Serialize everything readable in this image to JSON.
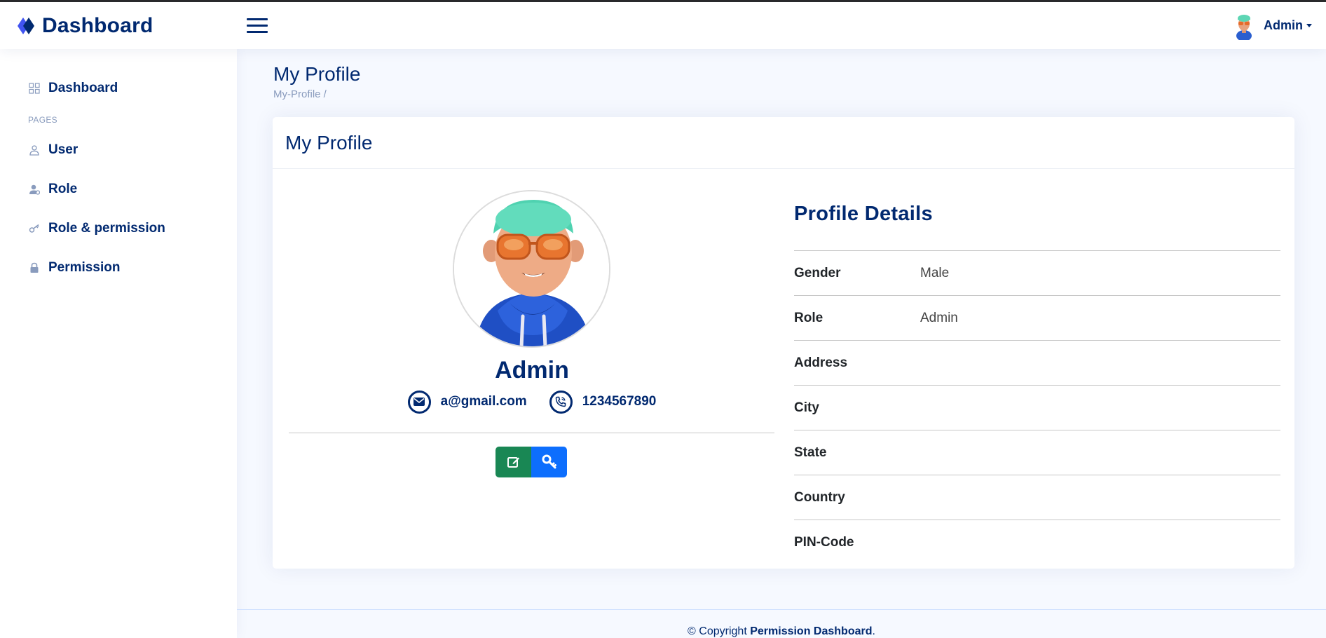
{
  "header": {
    "app_title": "Dashboard",
    "user_name": "Admin"
  },
  "sidebar": {
    "items": [
      {
        "label": "Dashboard",
        "icon": "grid-icon"
      },
      {
        "label": "User",
        "icon": "person-icon"
      },
      {
        "label": "Role",
        "icon": "person-badge-icon"
      },
      {
        "label": "Role & permission",
        "icon": "key-icon"
      },
      {
        "label": "Permission",
        "icon": "lock-icon"
      }
    ],
    "section_heading": "PAGES"
  },
  "page": {
    "title": "My Profile",
    "breadcrumb": "My-Profile /"
  },
  "card": {
    "title": "My Profile",
    "name": "Admin",
    "email": "a@gmail.com",
    "phone": "1234567890",
    "buttons": {
      "edit_icon": "pencil-square-icon",
      "key_icon": "key-icon",
      "edit_color": "#198754",
      "key_color": "#0d6efd"
    }
  },
  "details": {
    "title": "Profile Details",
    "rows": [
      {
        "label": "Gender",
        "value": "Male"
      },
      {
        "label": "Role",
        "value": "Admin"
      },
      {
        "label": "Address",
        "value": ""
      },
      {
        "label": "City",
        "value": ""
      },
      {
        "label": "State",
        "value": ""
      },
      {
        "label": "Country",
        "value": ""
      },
      {
        "label": "PIN-Code",
        "value": ""
      }
    ]
  },
  "footer": {
    "prefix": "© Copyright",
    "brand": "Permission Dashboard",
    "suffix": "."
  },
  "colors": {
    "brand": "#012970",
    "accent": "#4154f1",
    "muted": "#899bbd"
  }
}
